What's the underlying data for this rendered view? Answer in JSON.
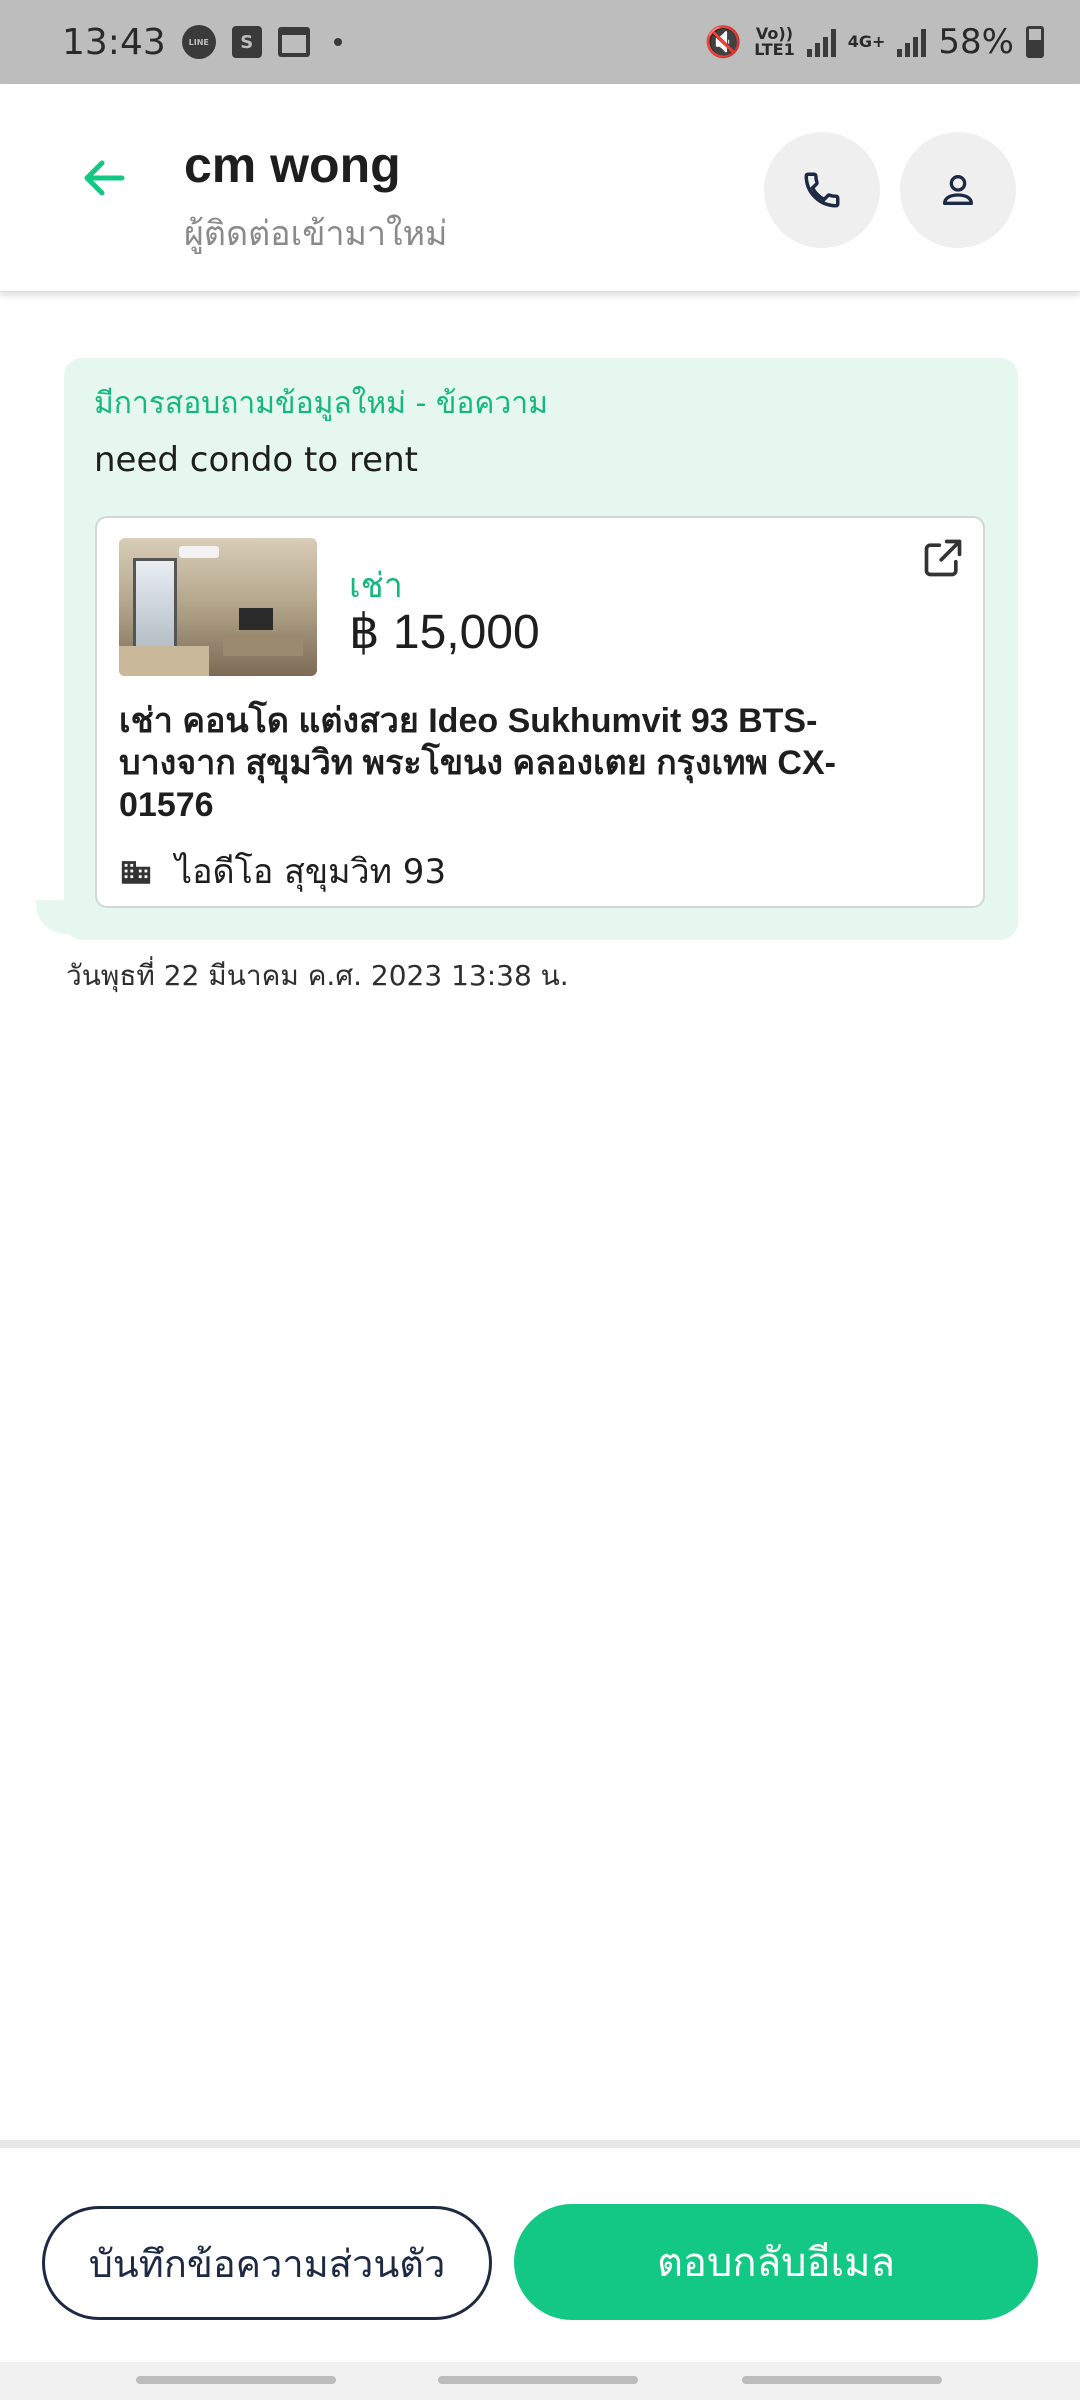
{
  "status_bar": {
    "time": "13:43",
    "notif_line": "LINE",
    "notif_bag": "S",
    "network_volte": "Vo))",
    "network_lte": "LTE1",
    "network_4g": "4G+",
    "battery": "58%",
    "battery_level": 0.58
  },
  "header": {
    "name": "cm wong",
    "subtitle": "ผู้ติดต่อเข้ามาใหม่"
  },
  "message": {
    "heading": "มีการสอบถามข้อมูลใหม่ - ข้อความ",
    "body": "need condo to rent",
    "listing": {
      "type": "เช่า",
      "price": "฿ 15,000",
      "title": "เช่า คอนโด แต่งสวย Ideo Sukhumvit 93 BTS-บางจาก สุขุมวิท พระโขนง คลองเตย กรุงเทพ CX-01576",
      "project": "ไอดีโอ สุขุมวิท 93"
    },
    "timestamp": "วันพุธที่ 22 มีนาคม ค.ศ. 2023 13:38 น."
  },
  "actions": {
    "private_note": "บันทึกข้อความส่วนตัว",
    "reply_email": "ตอบกลับอีเมล"
  },
  "colors": {
    "accent": "#13c784",
    "bubble": "#e6f7f0",
    "navy": "#1e2a44"
  },
  "icons": {
    "back": "arrow-left-icon",
    "call": "phone-icon",
    "profile": "person-icon",
    "external": "external-link-icon",
    "building": "building-icon"
  }
}
